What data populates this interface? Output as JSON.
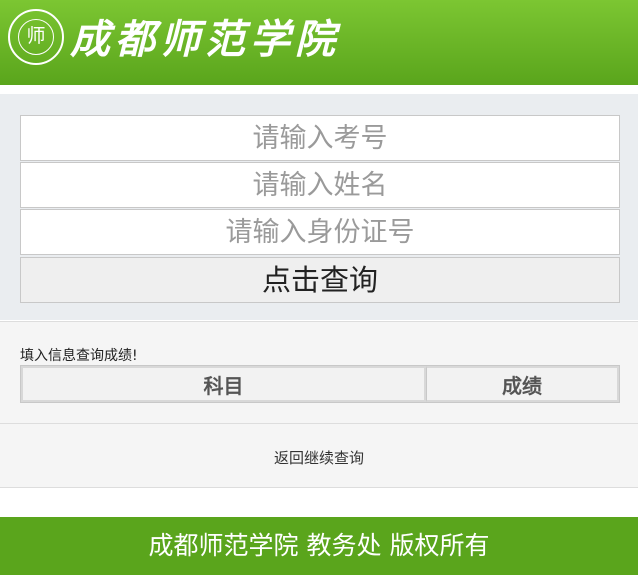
{
  "header": {
    "logo_alt": "seal",
    "seal_char": "师",
    "title": "成都师范学院"
  },
  "form": {
    "exam_no_placeholder": "请输入考号",
    "name_placeholder": "请输入姓名",
    "id_placeholder": "请输入身份证号",
    "submit_label": "点击查询"
  },
  "results": {
    "hint": "填入信息查询成绩!",
    "columns": [
      "科目",
      "成绩"
    ]
  },
  "back": {
    "label": "返回继续查询"
  },
  "footer": {
    "text": "成都师范学院 教务处 版权所有"
  },
  "colors": {
    "brand_green": "#5aa51c",
    "brand_green_light": "#7cc632"
  }
}
